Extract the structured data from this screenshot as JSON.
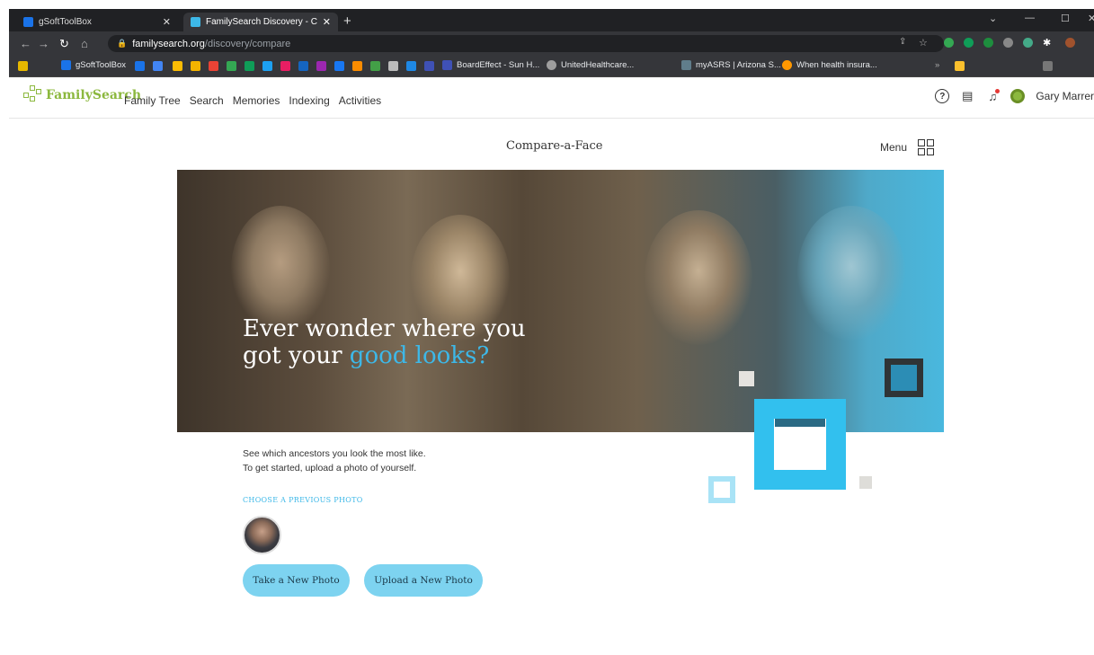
{
  "browser": {
    "tabs": [
      {
        "title": "gSoftToolBox",
        "favicon_color": "#1a73e8"
      },
      {
        "title": "FamilySearch Discovery - Compa",
        "favicon_color": "#3db8e8"
      }
    ],
    "url_host": "familysearch.org",
    "url_path": "/discovery/compare",
    "bookmarks": [
      {
        "label": "gSoftToolBox",
        "color": "#1a73e8"
      },
      {
        "label": "BoardEffect - Sun H...",
        "color": "#3f51b5"
      },
      {
        "label": "UnitedHealthcare...",
        "color": "#9e9e9e"
      },
      {
        "label": "myASRS | Arizona S...",
        "color": "#607d8b"
      },
      {
        "label": "When health insura...",
        "color": "#ff9800"
      }
    ]
  },
  "site": {
    "logo": "FamilySearch",
    "nav": [
      "Family Tree",
      "Search",
      "Memories",
      "Indexing",
      "Activities"
    ],
    "user_name": "Gary Marrer"
  },
  "page": {
    "title": "Compare-a-Face",
    "menu_label": "Menu",
    "hero_line1": "Ever wonder where you",
    "hero_line2_plain": "got your ",
    "hero_line2_accent": "good looks?",
    "desc_line1": "See which ancestors you look the most like.",
    "desc_line2": "To get started, upload a photo of yourself.",
    "previous_photo_label": "CHOOSE A PREVIOUS PHOTO",
    "take_photo_button": "Take a New Photo",
    "upload_photo_button": "Upload a New Photo"
  },
  "colors": {
    "accent": "#3db8e8",
    "button_bg": "#7dd3f0",
    "brand_green": "#8cb83e"
  }
}
